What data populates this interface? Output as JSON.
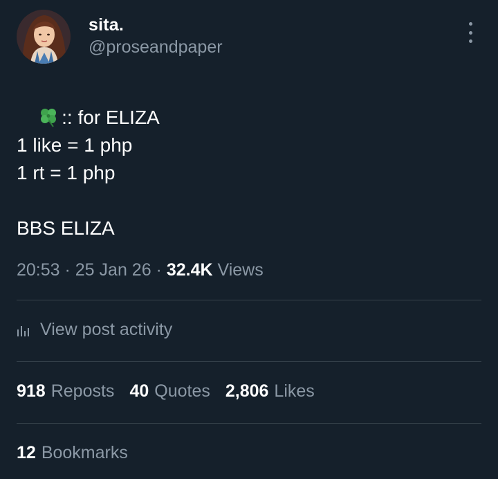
{
  "author": {
    "display_name": "sita.",
    "handle": "@proseandpaper"
  },
  "post": {
    "line1": ":: for ELIZA",
    "line2": "",
    "line3": "1 like = 1 php",
    "line4": "1 rt = 1 php",
    "line5": "",
    "line6": "BBS ELIZA"
  },
  "meta": {
    "time": "20:53",
    "separator": " · ",
    "date": "25 Jan 26",
    "views_count": "32.4K",
    "views_label": "Views"
  },
  "activity": {
    "label": "View post activity",
    "icon": "analytics-icon"
  },
  "stats": {
    "reposts_count": "918",
    "reposts_label": "Reposts",
    "quotes_count": "40",
    "quotes_label": "Quotes",
    "likes_count": "2,806",
    "likes_label": "Likes"
  },
  "bookmarks": {
    "count": "12",
    "label": "Bookmarks"
  },
  "colors": {
    "background": "#15202b",
    "secondary_text": "#8b98a5",
    "divider": "#38444d",
    "primary_text": "#ffffff"
  }
}
